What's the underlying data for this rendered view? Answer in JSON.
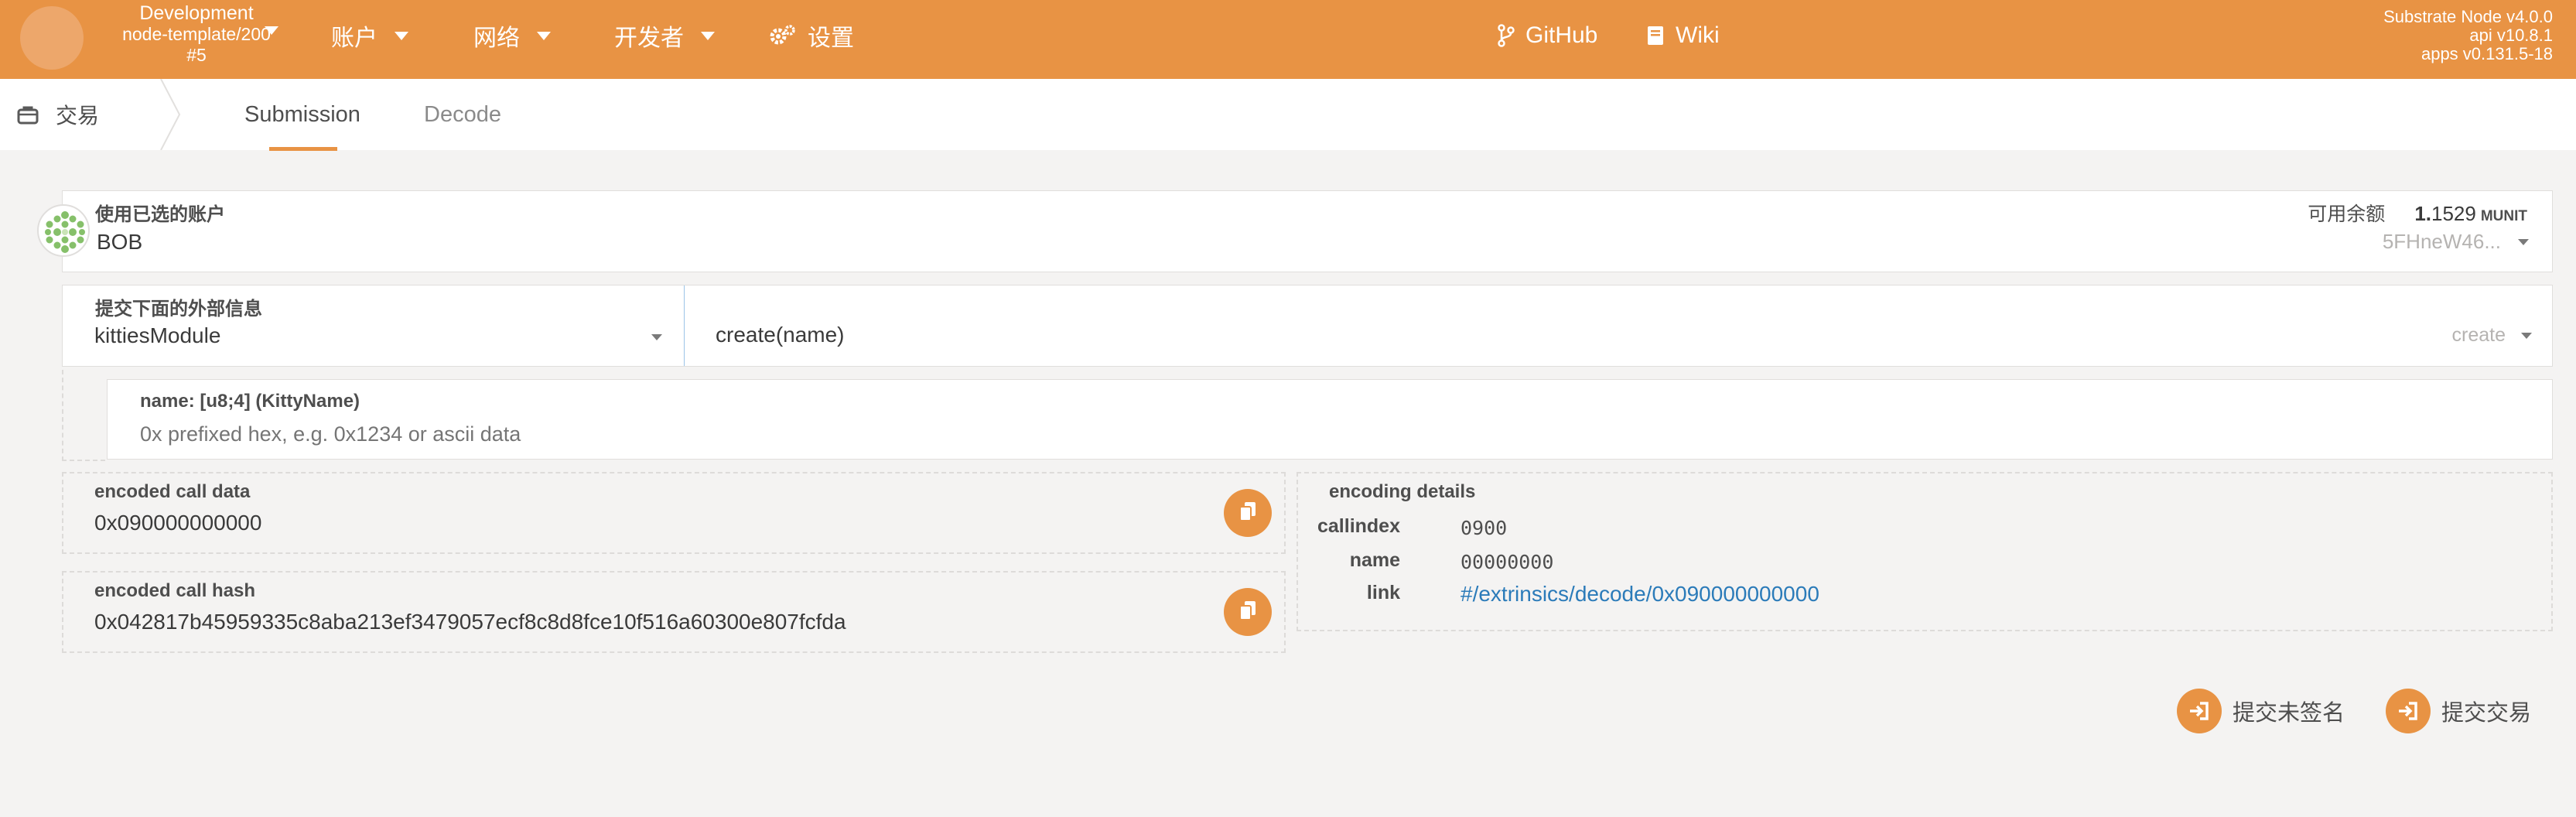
{
  "header": {
    "chain_name": "Development",
    "node_name": "node-template/200",
    "block": "#5",
    "nav": [
      {
        "label": "账户"
      },
      {
        "label": "网络"
      },
      {
        "label": "开发者"
      },
      {
        "label": "设置"
      }
    ],
    "github_label": "GitHub",
    "wiki_label": "Wiki",
    "version": {
      "node": "Substrate Node v4.0.0",
      "api": "api v10.8.1",
      "apps": "apps v0.131.5-18"
    }
  },
  "tabs": {
    "section_label": "交易",
    "items": [
      {
        "label": "Submission",
        "active": true
      },
      {
        "label": "Decode",
        "active": false
      }
    ]
  },
  "account": {
    "label": "使用已选的账户",
    "name": "BOB",
    "balance_label": "可用余额",
    "balance_int": "1.",
    "balance_dec": "1529",
    "balance_unit": "MUNIT",
    "address": "5FHneW46..."
  },
  "extrinsic": {
    "label": "提交下面的外部信息",
    "module": "kittiesModule",
    "call": "create(name)",
    "method": "create"
  },
  "param": {
    "label": "name: [u8;4] (KittyName)",
    "placeholder": "0x prefixed hex, e.g. 0x1234 or ascii data"
  },
  "encoded_data": {
    "label": "encoded call data",
    "value": "0x090000000000"
  },
  "encoded_hash": {
    "label": "encoded call hash",
    "value": "0x042817b45959335c8aba213ef3479057ecf8c8d8fce10f516a60300e807fcfda"
  },
  "encoding_details": {
    "title": "encoding details",
    "callindex_label": "callindex",
    "callindex_value": "0900",
    "name_label": "name",
    "name_value": "00000000",
    "link_label": "link",
    "link_value": "#/extrinsics/decode/0x090000000000"
  },
  "actions": {
    "submit_unsigned": "提交未签名",
    "submit": "提交交易"
  },
  "colors": {
    "accent": "#e89344",
    "link": "#2b7bb9",
    "background": "#f4f3f2"
  }
}
